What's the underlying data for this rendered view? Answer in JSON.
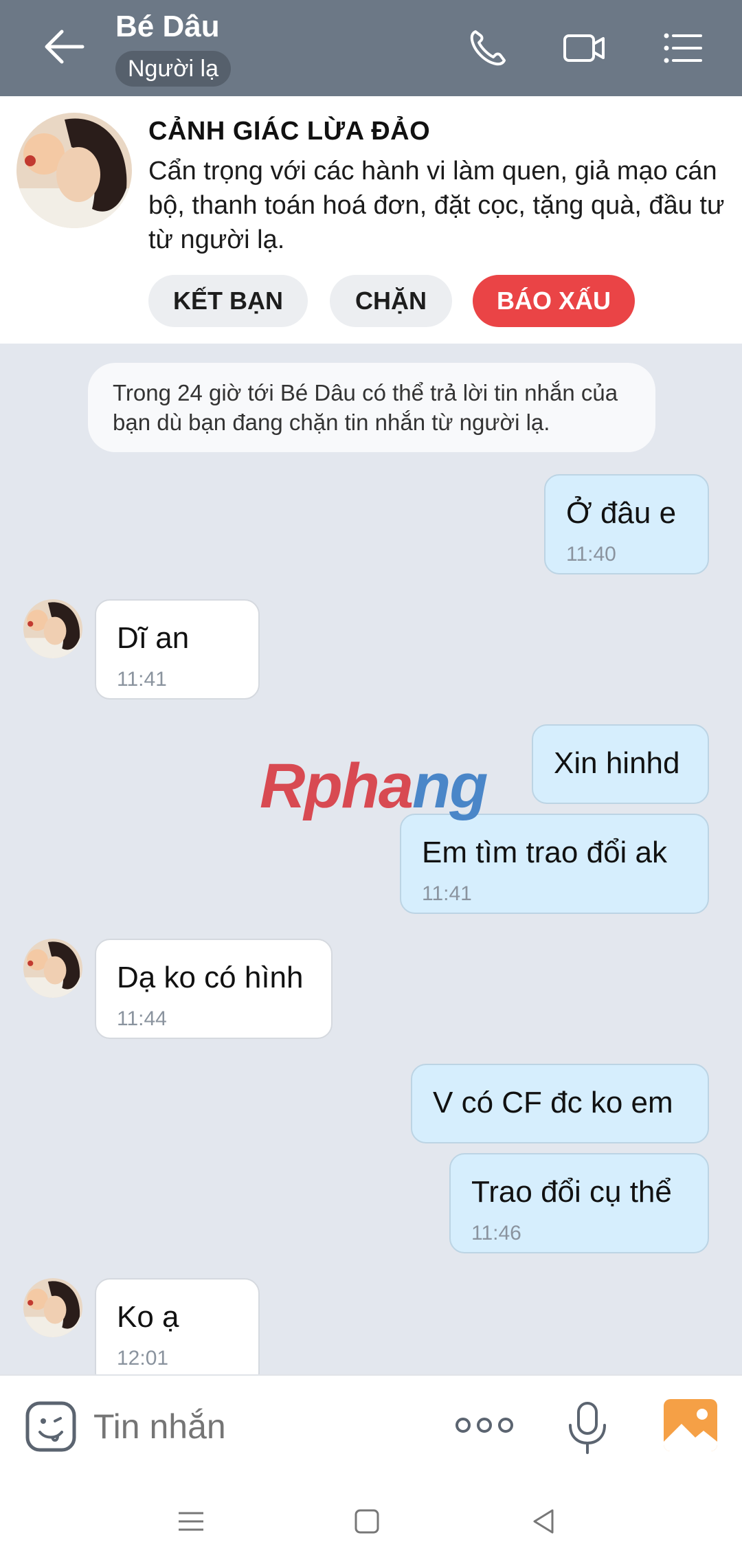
{
  "header": {
    "title": "Bé Dâu",
    "badge": "Người lạ"
  },
  "warning": {
    "title": "CẢNH GIÁC LỪA ĐẢO",
    "text": "Cẩn trọng với các hành vi làm quen, giả mạo cán bộ, thanh toán hoá đơn, đặt cọc, tặng quà, đầu tư từ người lạ.",
    "buttons": {
      "add_friend": "KẾT BẠN",
      "block": "CHẶN",
      "report": "BÁO XẤU"
    }
  },
  "notice": "Trong 24 giờ tới Bé Dâu có thể trả lời tin nhắn của bạn dù bạn đang chặn tin nhắn từ người lạ.",
  "messages": [
    {
      "text": "Ở đâu e",
      "time": "11:40",
      "dir": "out"
    },
    {
      "text": "Dĩ an",
      "time": "11:41",
      "dir": "in"
    },
    {
      "text": "Xin hinhd",
      "time": "",
      "dir": "out"
    },
    {
      "text": "Em tìm trao đổi ak",
      "time": "11:41",
      "dir": "out"
    },
    {
      "text": "Dạ ko có hình",
      "time": "11:44",
      "dir": "in"
    },
    {
      "text": "V có CF đc ko em",
      "time": "",
      "dir": "out"
    },
    {
      "text": "Trao đổi cụ thể",
      "time": "11:46",
      "dir": "out"
    },
    {
      "text": "Ko ạ",
      "time": "12:01",
      "dir": "in"
    }
  ],
  "watermark": {
    "part1": "Rpha",
    "part2": "ng"
  },
  "input": {
    "placeholder": "Tin nhắn"
  },
  "colors": {
    "header_bg": "#6c7886",
    "report_red": "#ea4446",
    "outgoing_bubble": "#d6eefd",
    "chat_bg": "#e3e7ee",
    "image_icon": "#f5a046"
  },
  "icons": [
    "back-arrow-icon",
    "phone-icon",
    "video-icon",
    "menu-icon",
    "sticker-icon",
    "more-dots-icon",
    "mic-icon",
    "image-icon",
    "nav-menu-icon",
    "nav-home-icon",
    "nav-back-icon"
  ]
}
